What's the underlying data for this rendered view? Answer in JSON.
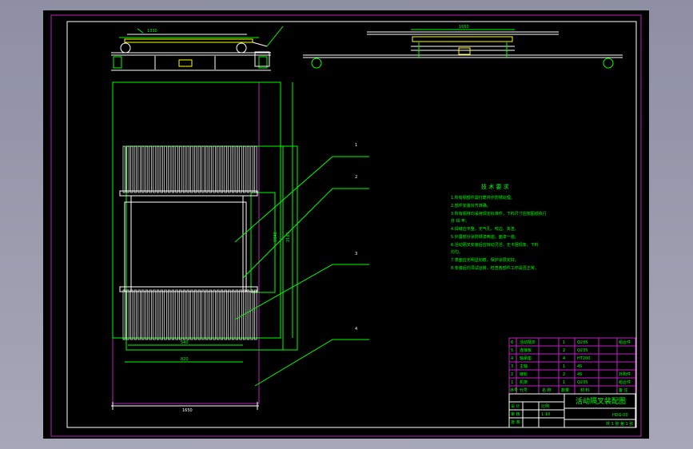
{
  "drawing": {
    "title": "活动隔叉装配图",
    "drawing_no": "HDG-00",
    "sheet_info": "共 1 张  第 1 张"
  },
  "notes": {
    "heading": "技 术 要 求",
    "lines": [
      "1.所有钢部件需打磨并作防锈处理。",
      "2.部件安装对齐准确。",
      "3.所有钢材均采用规定标准件，下料尺寸应按图纸执行",
      "  并 焊 牢。",
      "4.焊缝应平整，无气孔、咬边、夹渣。",
      "5.外露部分涂防锈漆两遍，面漆一遍。",
      "6.活动隔叉安装后应转动灵活，无卡阻现象，下料",
      "  均匀。",
      "7.表面应无明显划痕，保护涂层完好。",
      "8.安装后均须试运转，检查各部件工作是否正常。"
    ]
  },
  "dimensions": {
    "bottom_overall": "1650",
    "bottom_inner": "820",
    "bottom_small": "540",
    "side_outer": "2165",
    "side_inner": "1840",
    "top_left": "1330",
    "top_right": "1650"
  },
  "parts_list": {
    "rows": [
      {
        "no": "6",
        "name": "活动隔叉",
        "qty": "1",
        "material": "Q235",
        "remark": "组合件"
      },
      {
        "no": "5",
        "name": "连接板",
        "qty": "2",
        "material": "Q235",
        "remark": ""
      },
      {
        "no": "4",
        "name": "轴承座",
        "qty": "4",
        "material": "HT200",
        "remark": ""
      },
      {
        "no": "3",
        "name": "主轴",
        "qty": "1",
        "material": "45",
        "remark": ""
      },
      {
        "no": "2",
        "name": "链轮",
        "qty": "2",
        "material": "45",
        "remark": "外购件"
      },
      {
        "no": "1",
        "name": "机架",
        "qty": "1",
        "material": "Q235",
        "remark": "组合件"
      }
    ],
    "header": {
      "no": "序号",
      "code": "代号",
      "name": "名 称",
      "qty": "数量",
      "material": "材 料",
      "remark": "备 注"
    }
  },
  "title_block": {
    "design_label": "设 计",
    "check_label": "审 核",
    "approve_label": "批 准",
    "scale_label": "比例",
    "scale_value": "1:10"
  },
  "leaders": [
    "1",
    "2",
    "3",
    "4"
  ],
  "colors": {
    "sheet_bg": "#000000",
    "border": "#c020c0",
    "frame": "#ffffff",
    "lines": "#ffffff",
    "dims": "#00ff00",
    "text": "#00ff00",
    "table": "#c020c0"
  }
}
